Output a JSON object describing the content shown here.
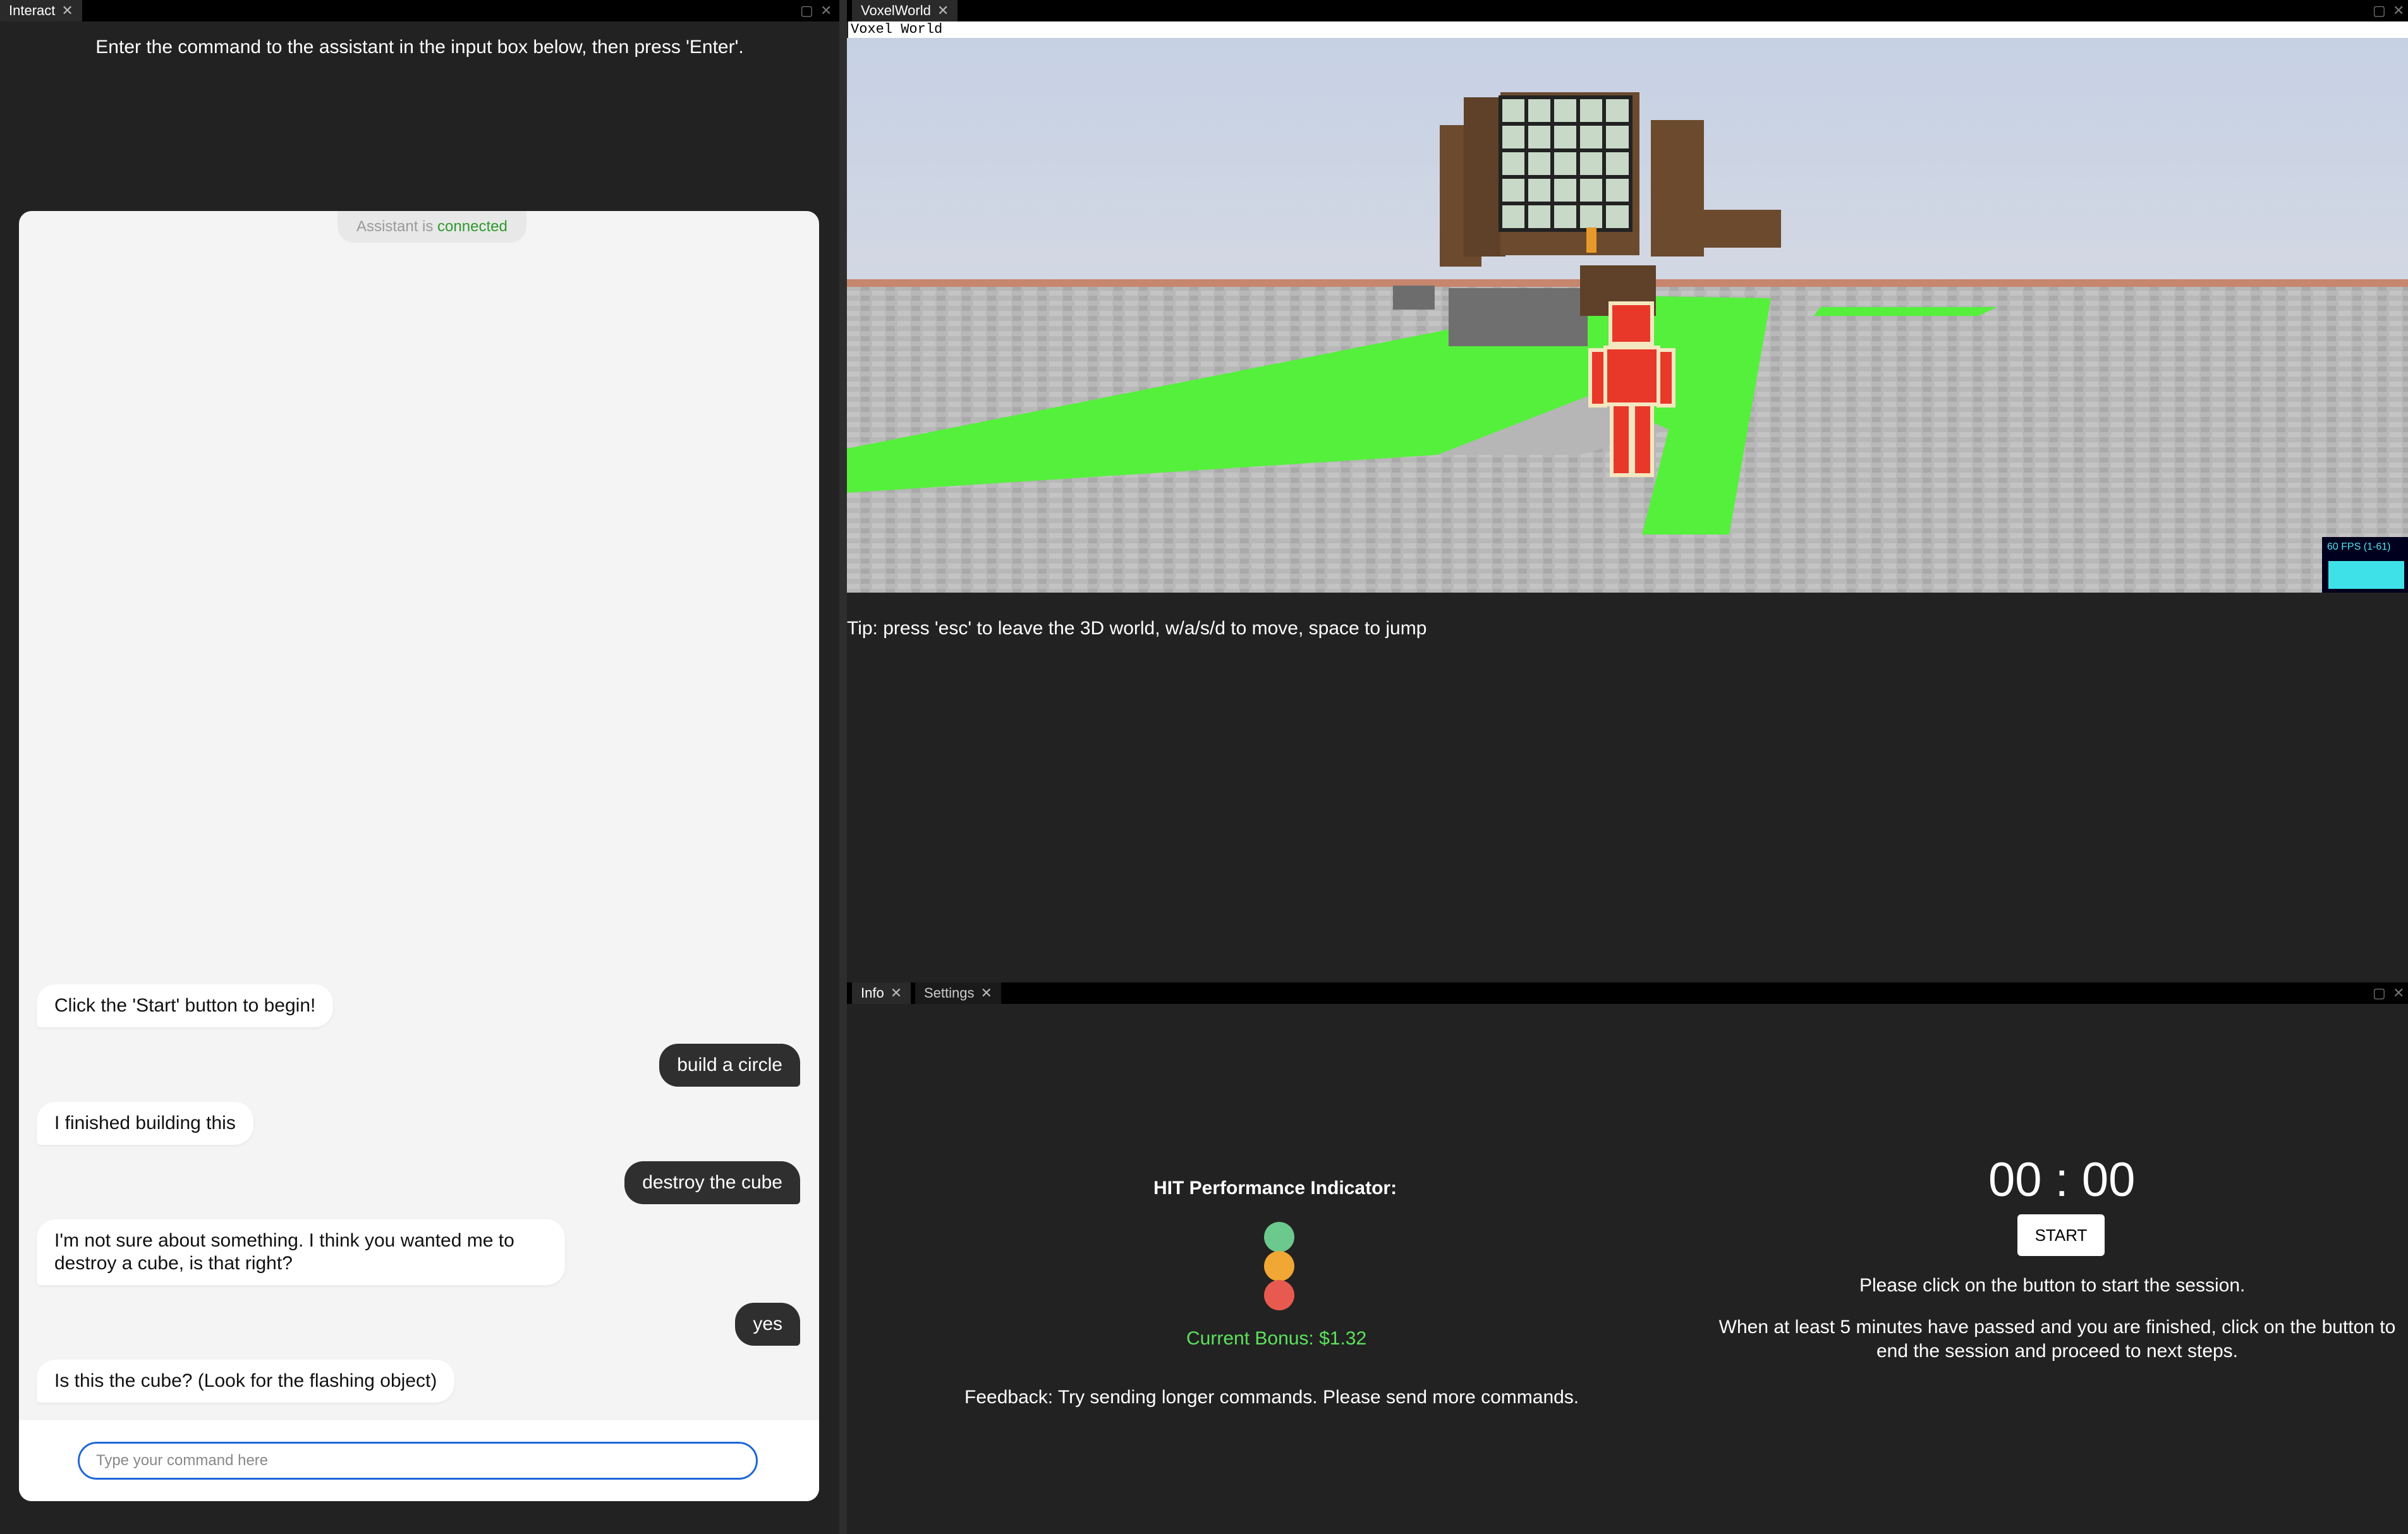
{
  "left_pane": {
    "tab_label": "Interact",
    "instruction": "Enter the command to the assistant in the input box below, then press 'Enter'.",
    "chat": {
      "status_prefix": "Assistant is",
      "status_value": "connected",
      "messages": [
        {
          "role": "assistant",
          "text": "Click the 'Start' button to begin!"
        },
        {
          "role": "user",
          "text": "build a circle"
        },
        {
          "role": "assistant",
          "text": "I finished building this"
        },
        {
          "role": "user",
          "text": "destroy the cube"
        },
        {
          "role": "assistant",
          "text": "I'm not sure about something. I think you wanted me to destroy a cube, is that right?"
        },
        {
          "role": "user",
          "text": "yes"
        },
        {
          "role": "assistant",
          "text": "Is this the cube? (Look for the flashing object)"
        }
      ],
      "input_placeholder": "Type your command here",
      "input_value": ""
    }
  },
  "voxel_pane": {
    "tab_label": "VoxelWorld",
    "canvas_label": "Voxel World",
    "fps_label": "60 FPS (1-61)",
    "tip": "Tip: press 'esc' to leave the 3D world, w/a/s/d to move, space to jump"
  },
  "info_pane": {
    "tabs": [
      {
        "label": "Info"
      },
      {
        "label": "Settings"
      }
    ],
    "hit_label": "HIT Performance Indicator:",
    "lights": [
      "#6cc98d",
      "#f0a733",
      "#e85a4f"
    ],
    "bonus": "Current Bonus: $1.32",
    "feedback": "Feedback: Try sending longer commands. Please send more commands.",
    "timer": "00 : 00",
    "start_label": "START",
    "instruction_1": "Please click on the button to start the session.",
    "instruction_2_line1": "When at least 5 minutes have passed and you are finished, click on the button to",
    "instruction_2_line2": "end the session and proceed to next steps."
  }
}
